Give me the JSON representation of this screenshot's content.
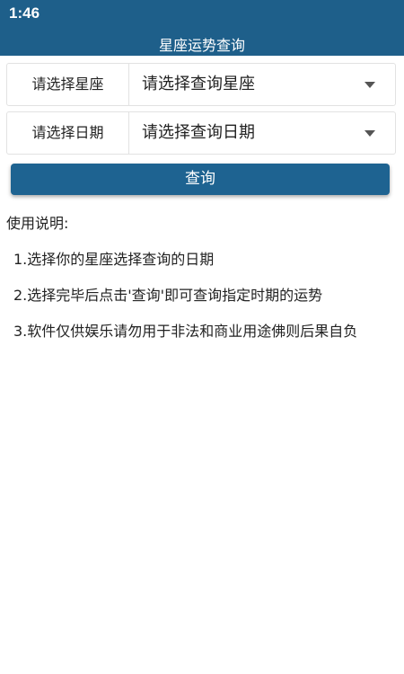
{
  "status_bar": {
    "time": "1:46"
  },
  "app_bar": {
    "title": "星座运势查询"
  },
  "form": {
    "sign": {
      "label": "请选择星座",
      "value": "请选择查询星座"
    },
    "date": {
      "label": "请选择日期",
      "value": "请选择查询日期"
    },
    "query_label": "查询"
  },
  "instructions": {
    "title": "使用说明:",
    "items": [
      "1.选择你的星座选择查询的日期",
      "2.选择完毕后点击'查询'即可查询指定时期的运势",
      "3.软件仅供娱乐请勿用于非法和商业用途佛则后果自负"
    ]
  },
  "colors": {
    "primary": "#1e5f8a",
    "button": "#1e6391",
    "border": "#e2e2e2",
    "text": "#222222"
  },
  "icons": {
    "dropdown": "chevron-down-icon"
  }
}
